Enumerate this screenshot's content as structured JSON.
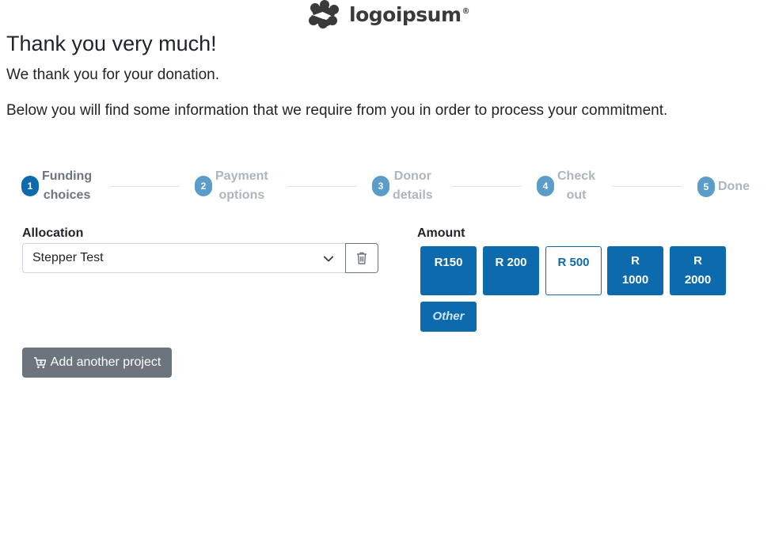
{
  "brand": {
    "name": "logoipsum",
    "tm": "®"
  },
  "header": {
    "title": "Thank you very much!",
    "line1": "We thank you for your donation.",
    "line2": "Below you will find some information that we require from you in order to process your commitment."
  },
  "stepper": {
    "steps": [
      {
        "num": "1",
        "label1": "Funding",
        "label2": "choices",
        "active": true
      },
      {
        "num": "2",
        "label1": "Payment",
        "label2": "options",
        "active": false
      },
      {
        "num": "3",
        "label1": "Donor",
        "label2": "details",
        "active": false
      },
      {
        "num": "4",
        "label1": "Check",
        "label2": "out",
        "active": false
      },
      {
        "num": "5",
        "label1": "Done",
        "label2": "",
        "active": false
      }
    ]
  },
  "allocation": {
    "label": "Allocation",
    "selected": "Stepper Test"
  },
  "amount": {
    "label": "Amount",
    "options": [
      {
        "line1": "R150",
        "line2": ""
      },
      {
        "line1": "R 200",
        "line2": ""
      },
      {
        "line1": "R 500",
        "line2": "",
        "selected": true
      },
      {
        "line1": "R",
        "line2": "1000"
      },
      {
        "line1": "R",
        "line2": "2000"
      },
      {
        "line1": "Other",
        "line2": ""
      }
    ]
  },
  "actions": {
    "add_project": "Add another project"
  },
  "icons": {
    "chevron": "chevron-down-icon",
    "trash": "trash-icon",
    "cart": "cart-icon"
  },
  "colors": {
    "primary": "#0d6aad",
    "step_inactive": "#5a9cca",
    "secondary": "#6c757d"
  }
}
